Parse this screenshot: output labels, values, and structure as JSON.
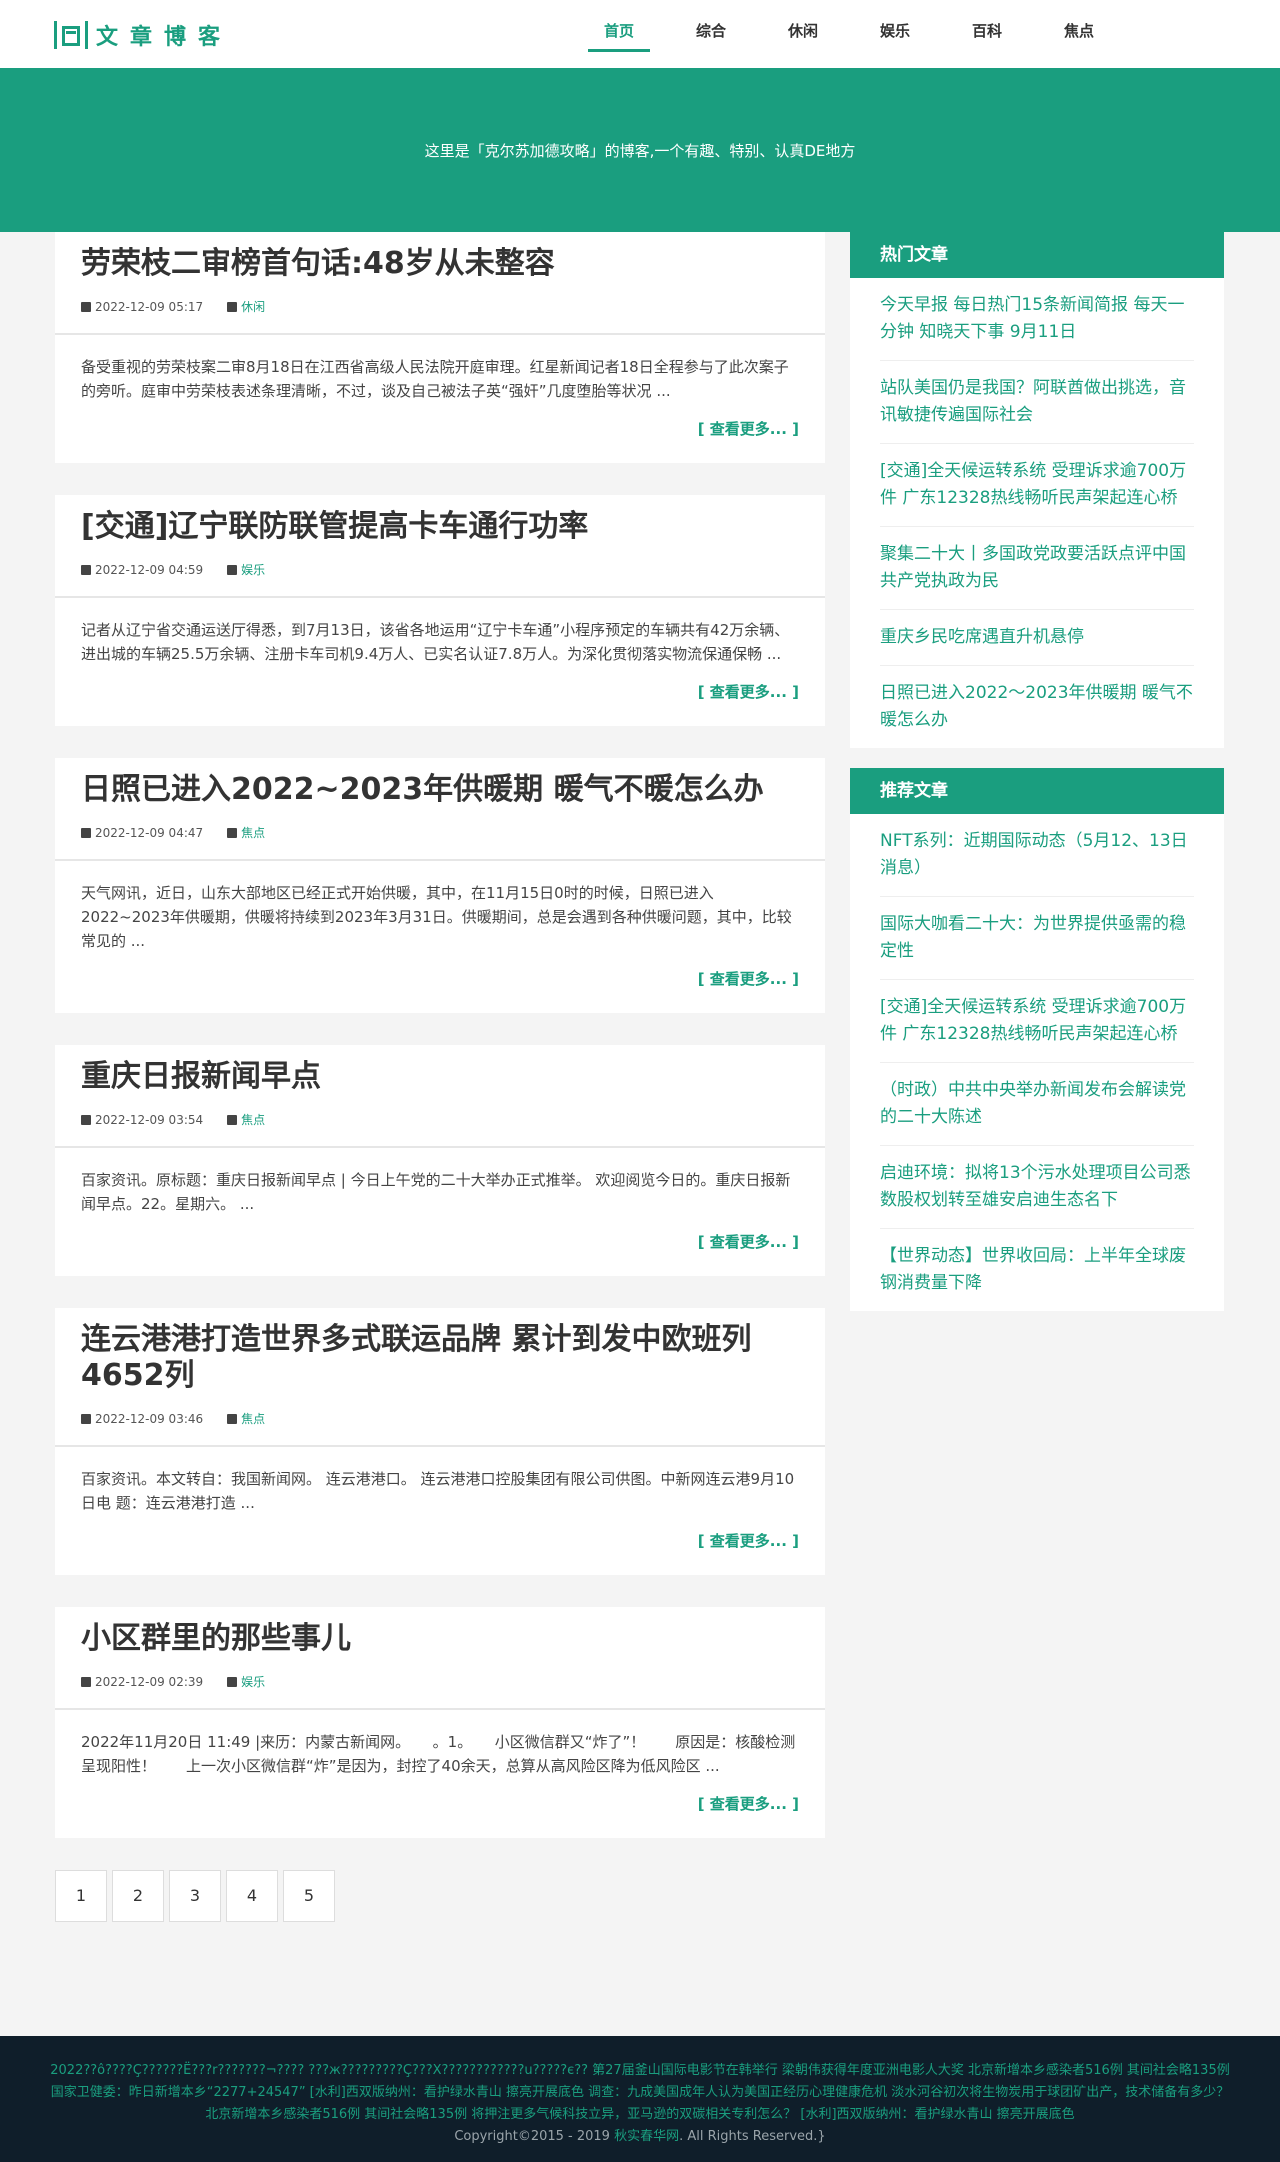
{
  "header": {
    "logo_text": "文章博客",
    "nav": [
      "首页",
      "综合",
      "休闲",
      "娱乐",
      "百科",
      "焦点"
    ]
  },
  "banner": {
    "text": "这里是「克尔苏加德攻略」的博客,一个有趣、特别、认真DE地方"
  },
  "articles": [
    {
      "title": "劳荣枝二审榜首句话:48岁从未整容",
      "date": "2022-12-09 05:17",
      "category": "休闲",
      "excerpt": "备受重视的劳荣枝案二审8月18日在江西省高级人民法院开庭审理。红星新闻记者18日全程参与了此次案子的旁听。庭审中劳荣枝表述条理清晰，不过，谈及自己被法子英“强奸”几度堕胎等状况 ...",
      "more": "[ 查看更多... ]"
    },
    {
      "title": "[交通]辽宁联防联管提高卡车通行功率",
      "date": "2022-12-09 04:59",
      "category": "娱乐",
      "excerpt": "记者从辽宁省交通运送厅得悉，到7月13日，该省各地运用“辽宁卡车通”小程序预定的车辆共有42万余辆、进出城的车辆25.5万余辆、注册卡车司机9.4万人、已实名认证7.8万人。为深化贯彻落实物流保通保畅 ...",
      "more": "[ 查看更多... ]"
    },
    {
      "title": "日照已进入2022~2023年供暖期 暖气不暖怎么办",
      "date": "2022-12-09 04:47",
      "category": "焦点",
      "excerpt": "天气网讯，近日，山东大部地区已经正式开始供暖，其中，在11月15日0时的时候，日照已进入2022~2023年供暖期，供暖将持续到2023年3月31日。供暖期间，总是会遇到各种供暖问题，其中，比较常见的 ...",
      "more": "[ 查看更多... ]"
    },
    {
      "title": "重庆日报新闻早点",
      "date": "2022-12-09 03:54",
      "category": "焦点",
      "excerpt": "百家资讯。原标题：重庆日报新闻早点 | 今日上午党的二十大举办正式推举。 欢迎阅览今日的。重庆日报新闻早点。22。星期六。 ...",
      "more": "[ 查看更多... ]"
    },
    {
      "title": "连云港港打造世界多式联运品牌 累计到发中欧班列4652列",
      "date": "2022-12-09 03:46",
      "category": "焦点",
      "excerpt": "百家资讯。本文转自：我国新闻网。 连云港港口。 连云港港口控股集团有限公司供图。中新网连云港9月10日电 题：连云港港打造 ...",
      "more": "[ 查看更多... ]"
    },
    {
      "title": "小区群里的那些事儿",
      "date": "2022-12-09 02:39",
      "category": "娱乐",
      "excerpt": "2022年11月20日 11:49 |来历：内蒙古新闻网。　　。1。　　小区微信群又“炸了”！　　原因是：核酸检测呈现阳性！　　上一次小区微信群“炸”是因为，封控了40余天，总算从高风险区降为低风险区 ...",
      "more": "[ 查看更多... ]"
    }
  ],
  "pagination": [
    "1",
    "2",
    "3",
    "4",
    "5"
  ],
  "sidebar": {
    "hot_title": "热门文章",
    "hot": [
      "今天早报 每日热门15条新闻简报 每天一分钟 知晓天下事 9月11日",
      "站队美国仍是我国？阿联酋做出挑选，音讯敏捷传遍国际社会",
      "[交通]全天候运转系统 受理诉求逾700万件 广东12328热线畅听民声架起连心桥",
      "聚集二十大丨多国政党政要活跃点评中国共产党执政为民",
      "重庆乡民吃席遇直升机悬停",
      "日照已进入2022～2023年供暖期 暖气不暖怎么办"
    ],
    "rec_title": "推荐文章",
    "rec": [
      "NFT系列：近期国际动态（5月12、13日消息）",
      "国际大咖看二十大：为世界提供亟需的稳定性",
      "[交通]全天候运转系统 受理诉求逾700万件 广东12328热线畅听民声架起连心桥",
      "（时政）中共中央举办新闻发布会解读党的二十大陈述",
      "启迪环境：拟将13个污水处理项目公司悉数股权划转至雄安启迪生态名下",
      "【世界动态】世界收回局：上半年全球废钢消费量下降"
    ]
  },
  "footer": {
    "links": "2022??ô????Ç??????Ё???r???????¬???? ???ж?????????Ç???X????????????u?????є?? 第27届釜山国际电影节在韩举行 梁朝伟获得年度亚洲电影人大奖 北京新增本乡感染者516例 其间社会略135例 国家卫健委：昨日新增本乡“2277+24547” [水利]西双版纳州：看护绿水青山 擦亮开展底色 调查：九成美国成年人认为美国正经历心理健康危机 淡水河谷初次将生物炭用于球团矿出产，技术储备有多少？ 北京新增本乡感染者516例 其间社会略135例 将押注更多气候科技立异，亚马逊的双碳相关专利怎么？ [水利]西双版纳州：看护绿水青山 擦亮开展底色",
    "copyright_prefix": "Copyright©2015 - 2019 ",
    "copyright_site": "秋实春华网",
    "copyright_suffix": ". All Rights Reserved.}"
  },
  "colors": {
    "brand": "#1a9e7f",
    "footer_bg": "#0f1e2a"
  }
}
